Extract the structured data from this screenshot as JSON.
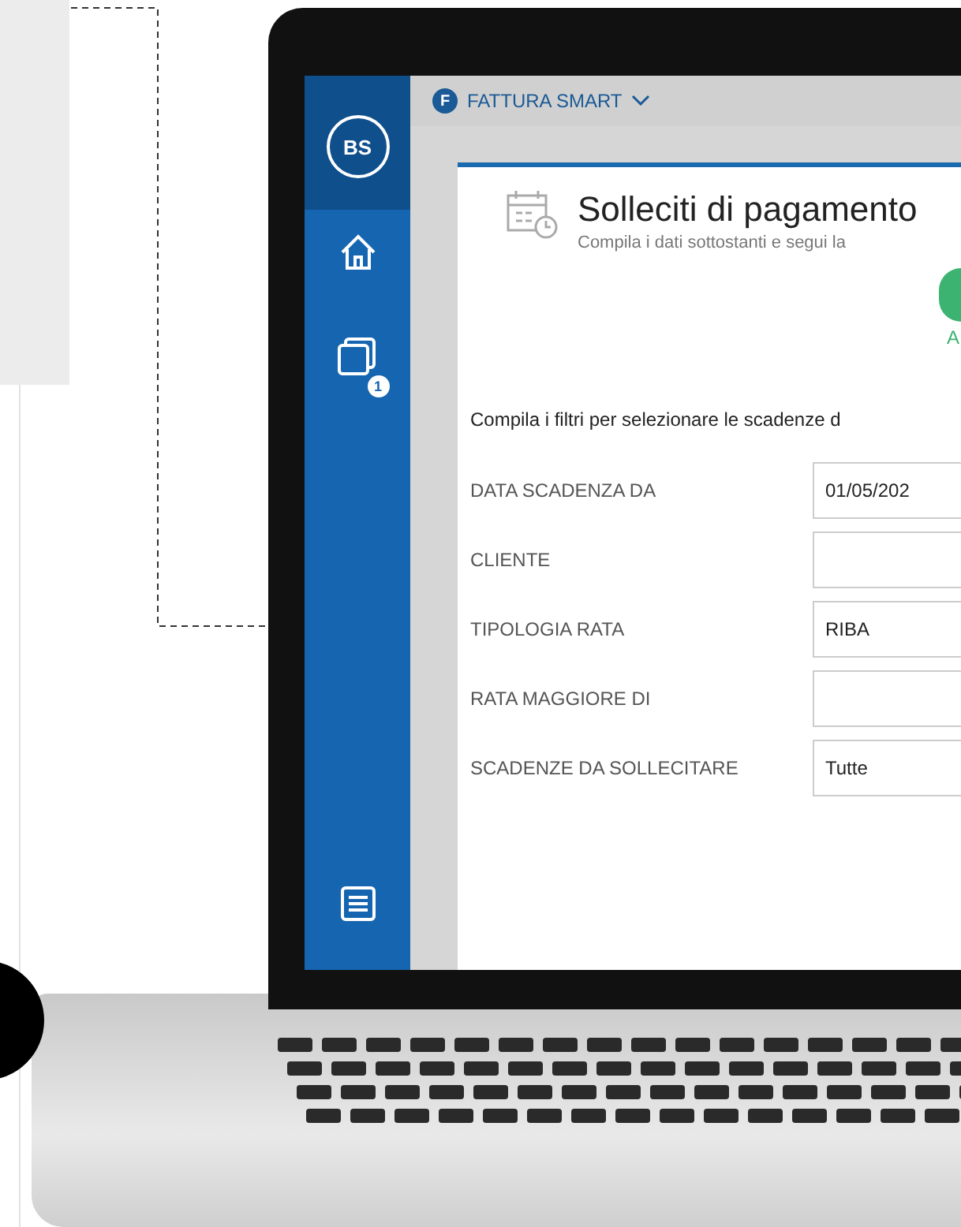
{
  "app_bar": {
    "badge_letter": "F",
    "title": "FATTURA SMART"
  },
  "sidebar": {
    "avatar": "BS",
    "badge": "1"
  },
  "card": {
    "title": "Solleciti di pagamento",
    "subtitle": "Compila i dati sottostanti e segui la",
    "step_label": "A",
    "instruction": "Compila i filtri per selezionare le scadenze d",
    "fields": [
      {
        "label": "DATA SCADENZA DA",
        "value": "01/05/202"
      },
      {
        "label": "CLIENTE"
      },
      {
        "label": "TIPOLOGIA RATA",
        "value": "RIBA"
      },
      {
        "label": "RATA MAGGIORE DI"
      },
      {
        "label": "SCADENZE DA SOLLECITARE",
        "value": "Tutte"
      }
    ]
  }
}
